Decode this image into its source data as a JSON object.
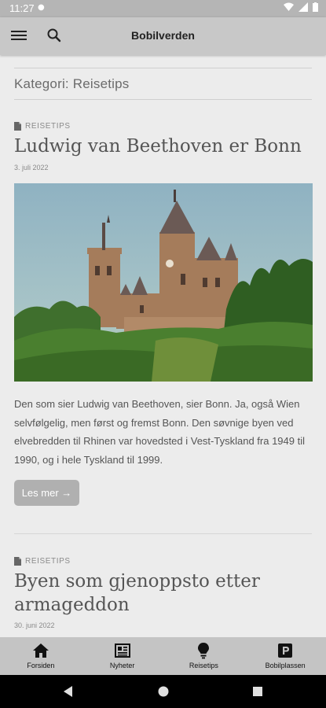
{
  "status_bar": {
    "time": "11:27"
  },
  "app_bar": {
    "title": "Bobilverden"
  },
  "category": {
    "title": "Kategori: Reisetips"
  },
  "posts": [
    {
      "category": "REISETIPS",
      "title": "Ludwig van Beethoven er Bonn",
      "date": "3. juli 2022",
      "excerpt": "Den som sier Ludwig van Beethoven, sier Bonn. Ja, også Wien selvfølgelig, men først og fremst Bonn. Den søvnige byen ved elvebredden til Rhinen var hovedsted i Vest-Tyskland fra 1949 til 1990, og i hele Tyskland til 1999.",
      "read_more": "Les mer →"
    },
    {
      "category": "REISETIPS",
      "title": "Byen som gjenoppsto etter armageddon",
      "date": "30. juni 2022"
    }
  ],
  "bottom_nav": [
    {
      "label": "Forsiden",
      "icon": "home-icon"
    },
    {
      "label": "Nyheter",
      "icon": "newspaper-icon"
    },
    {
      "label": "Reisetips",
      "icon": "lightbulb-icon"
    },
    {
      "label": "Bobilplassen",
      "icon": "parking-icon"
    }
  ],
  "colors": {
    "app_bar": "#c8c8c8",
    "background": "#ececec",
    "bottom_nav": "#c4c4c4",
    "button": "#b0b0b0"
  }
}
